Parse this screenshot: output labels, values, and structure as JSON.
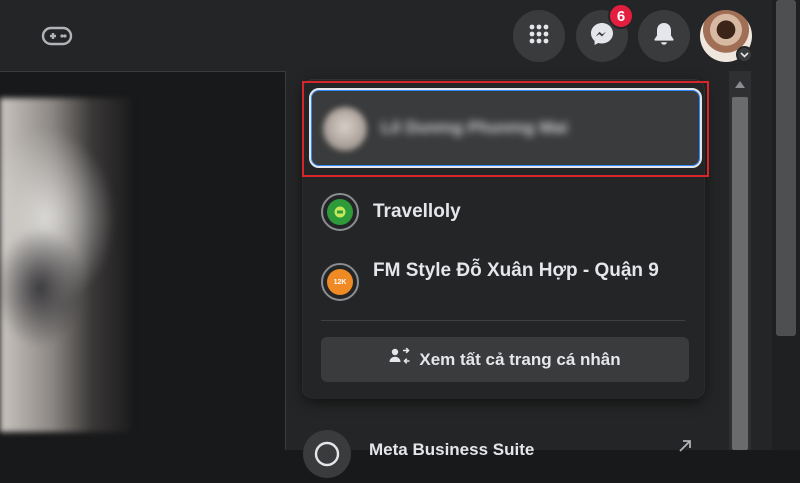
{
  "header": {
    "messenger_badge": "6",
    "icons": [
      "gaming-icon",
      "menu-grid-icon",
      "messenger-icon",
      "bell-icon",
      "chevron-down-icon"
    ]
  },
  "account_menu": {
    "current_profile_name": "Lê Dương Phương Mai",
    "pages": [
      {
        "name": "Travelloly",
        "icon_color": "#2e9b3a"
      },
      {
        "name": "FM Style Đỗ Xuân Hợp - Quận 9",
        "icon_color": "#f08a24",
        "icon_text": "12K"
      }
    ],
    "see_all_label": "Xem tất cả trang cá nhân",
    "next_item_label": "Meta Business Suite"
  },
  "colors": {
    "highlight_frame": "#d7262b",
    "badge": "#e41e3f",
    "surface": "#242526",
    "button": "#3a3b3c"
  }
}
